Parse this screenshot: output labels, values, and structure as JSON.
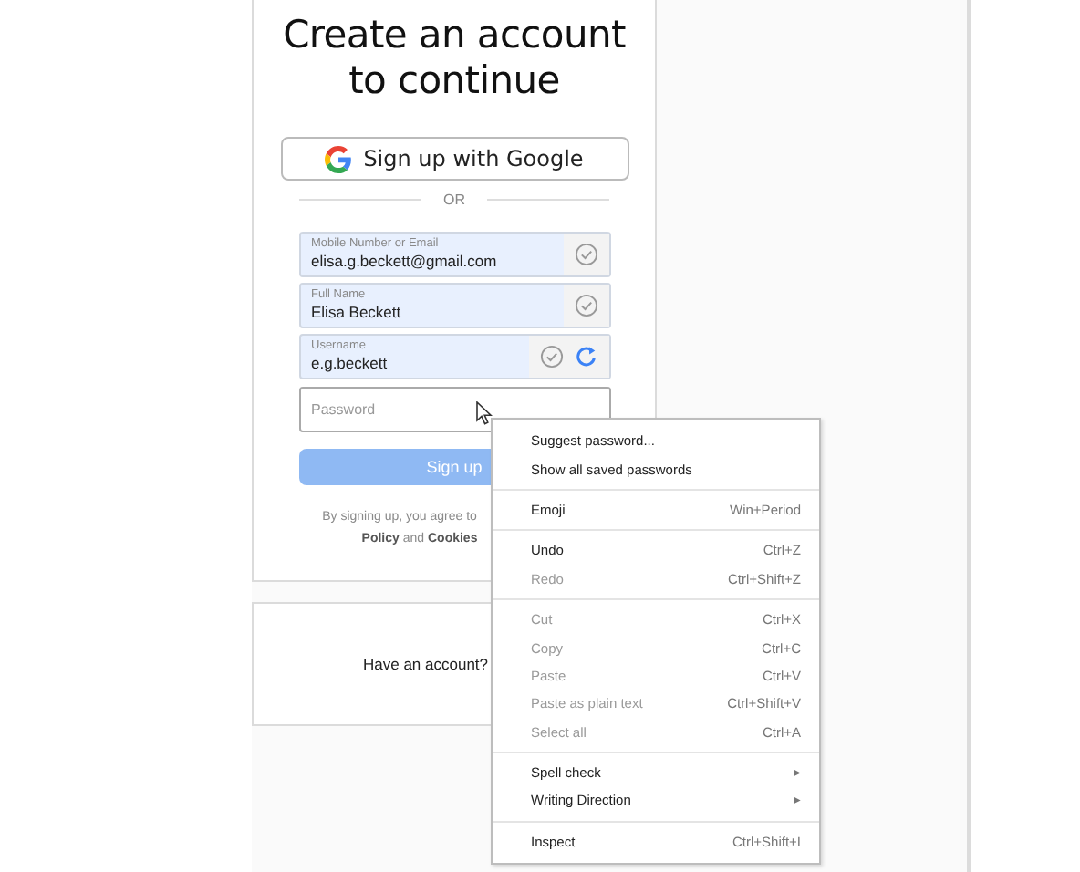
{
  "title": "Create an account to continue",
  "google_button": {
    "label": "Sign up with Google"
  },
  "divider": "OR",
  "fields": [
    {
      "label": "Mobile Number or Email",
      "value": "elisa.g.beckett@gmail.com",
      "valid": true,
      "refresh": false
    },
    {
      "label": "Full Name",
      "value": "Elisa Beckett",
      "valid": true,
      "refresh": false
    },
    {
      "label": "Username",
      "value": "e.g.beckett",
      "valid": true,
      "refresh": true
    },
    {
      "placeholder": "Password",
      "valid": false,
      "refresh": false
    }
  ],
  "signup_button": {
    "label": "Sign up",
    "disabled": true
  },
  "terms": [
    "By signing up, you agree to",
    "**Policy** and **Cookies**"
  ],
  "login_prompt": "Have an account?",
  "context_menu": [
    {
      "kind": "item",
      "label": "Suggest password...",
      "disabled": false
    },
    {
      "kind": "item",
      "label": "Show all saved passwords",
      "disabled": false
    },
    {
      "kind": "separator"
    },
    {
      "kind": "item",
      "label": "Emoji",
      "shortcut": "Win+Period",
      "disabled": false
    },
    {
      "kind": "separator"
    },
    {
      "kind": "item",
      "label": "Undo",
      "shortcut": "Ctrl+Z",
      "disabled": false
    },
    {
      "kind": "item",
      "label": "Redo",
      "shortcut": "Ctrl+Shift+Z",
      "disabled": true
    },
    {
      "kind": "separator"
    },
    {
      "kind": "item",
      "label": "Cut",
      "shortcut": "Ctrl+X",
      "disabled": true
    },
    {
      "kind": "item",
      "label": "Copy",
      "shortcut": "Ctrl+C",
      "disabled": true
    },
    {
      "kind": "item",
      "label": "Paste",
      "shortcut": "Ctrl+V",
      "disabled": true
    },
    {
      "kind": "item",
      "label": "Paste as plain text",
      "shortcut": "Ctrl+Shift+V",
      "disabled": true
    },
    {
      "kind": "item",
      "label": "Select all",
      "shortcut": "Ctrl+A",
      "disabled": true
    },
    {
      "kind": "separator"
    },
    {
      "kind": "submenu",
      "label": "Spell check",
      "arrow": "▶",
      "disabled": false
    },
    {
      "kind": "submenu",
      "label": "Writing Direction",
      "arrow": "▶",
      "disabled": false
    },
    {
      "kind": "separator"
    },
    {
      "kind": "item",
      "label": "Inspect",
      "shortcut": "Ctrl+Shift+I",
      "disabled": false
    }
  ]
}
